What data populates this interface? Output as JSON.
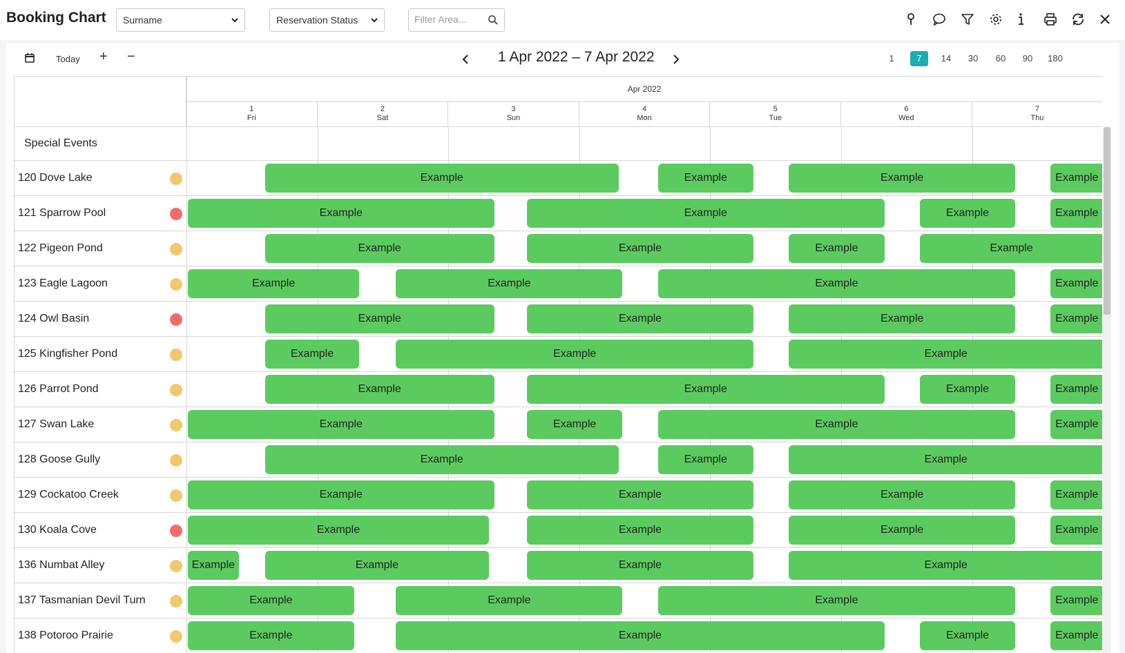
{
  "app": {
    "title": "Booking Chart",
    "sort_select": "Surname",
    "status_select": "Reservation Status",
    "search_placeholder": "Filter Area..."
  },
  "toolbar": {
    "today_label": "Today",
    "plus_label": "+",
    "minus_label": "−",
    "range_label": "1 Apr 2022 – 7 Apr 2022",
    "zoom_options": [
      "1",
      "7",
      "14",
      "30",
      "60",
      "90",
      "180"
    ],
    "zoom_active": "7"
  },
  "grid": {
    "month_label": "Apr 2022",
    "days": [
      {
        "num": "1",
        "dow": "Fri"
      },
      {
        "num": "2",
        "dow": "Sat"
      },
      {
        "num": "3",
        "dow": "Sun"
      },
      {
        "num": "4",
        "dow": "Mon"
      },
      {
        "num": "5",
        "dow": "Tue"
      },
      {
        "num": "6",
        "dow": "Wed"
      },
      {
        "num": "7",
        "dow": "Thu"
      }
    ],
    "special_events_label": "Special Events",
    "booking_label": "Example",
    "rows": [
      {
        "name": "120 Dove Lake",
        "status": "yellow",
        "bookings": [
          [
            0.6,
            3.3
          ],
          [
            3.6,
            4.33
          ],
          [
            4.6,
            6.33
          ],
          [
            6.6,
            7.0
          ]
        ]
      },
      {
        "name": "121 Sparrow Pool",
        "status": "red",
        "bookings": [
          [
            0.0,
            2.35
          ],
          [
            2.6,
            5.33
          ],
          [
            5.6,
            6.33
          ],
          [
            6.6,
            7.0
          ]
        ]
      },
      {
        "name": "122 Pigeon Pond",
        "status": "yellow",
        "bookings": [
          [
            0.6,
            2.35
          ],
          [
            2.6,
            4.33
          ],
          [
            4.6,
            5.33
          ],
          [
            5.6,
            7.0
          ]
        ]
      },
      {
        "name": "123 Eagle Lagoon",
        "status": "yellow",
        "bookings": [
          [
            0.0,
            1.32
          ],
          [
            1.6,
            3.33
          ],
          [
            3.6,
            6.33
          ],
          [
            6.6,
            7.0
          ]
        ]
      },
      {
        "name": "124 Owl Basin",
        "status": "red",
        "bookings": [
          [
            0.6,
            2.35
          ],
          [
            2.6,
            4.33
          ],
          [
            4.6,
            6.33
          ],
          [
            6.6,
            7.0
          ]
        ]
      },
      {
        "name": "125 Kingfisher Pond",
        "status": "yellow",
        "bookings": [
          [
            0.6,
            1.32
          ],
          [
            1.6,
            4.33
          ],
          [
            4.6,
            7.0
          ]
        ]
      },
      {
        "name": "126 Parrot Pond",
        "status": "yellow",
        "bookings": [
          [
            0.6,
            2.35
          ],
          [
            2.6,
            5.33
          ],
          [
            5.6,
            6.33
          ],
          [
            6.6,
            7.0
          ]
        ]
      },
      {
        "name": "127 Swan Lake",
        "status": "yellow",
        "bookings": [
          [
            0.0,
            2.35
          ],
          [
            2.6,
            3.33
          ],
          [
            3.6,
            6.33
          ],
          [
            6.6,
            7.0
          ]
        ]
      },
      {
        "name": "128 Goose Gully",
        "status": "yellow",
        "bookings": [
          [
            0.6,
            3.3
          ],
          [
            3.6,
            4.33
          ],
          [
            4.6,
            7.0
          ]
        ]
      },
      {
        "name": "129 Cockatoo Creek",
        "status": "yellow",
        "bookings": [
          [
            0.0,
            2.35
          ],
          [
            2.6,
            4.33
          ],
          [
            4.6,
            6.33
          ],
          [
            6.6,
            7.0
          ]
        ]
      },
      {
        "name": "130 Koala Cove",
        "status": "red",
        "bookings": [
          [
            0.0,
            2.31
          ],
          [
            2.6,
            4.33
          ],
          [
            4.6,
            6.33
          ],
          [
            6.6,
            7.0
          ]
        ]
      },
      {
        "name": "136 Numbat Alley",
        "status": "yellow",
        "bookings": [
          [
            0.0,
            0.4
          ],
          [
            0.6,
            2.31
          ],
          [
            2.6,
            4.33
          ],
          [
            4.6,
            7.0
          ]
        ]
      },
      {
        "name": "137 Tasmanian Devil Turn",
        "status": "yellow",
        "bookings": [
          [
            0.0,
            1.28
          ],
          [
            1.6,
            3.33
          ],
          [
            3.6,
            6.33
          ],
          [
            6.6,
            7.0
          ]
        ]
      },
      {
        "name": "138 Potoroo Prairie",
        "status": "yellow",
        "bookings": [
          [
            0.0,
            1.28
          ],
          [
            1.6,
            5.33
          ],
          [
            5.6,
            6.33
          ],
          [
            6.6,
            7.0
          ]
        ]
      }
    ]
  },
  "colors": {
    "booking": "#5ccb5f",
    "status_yellow": "#f2c76e",
    "status_red": "#f26b6b",
    "accent": "#1aaeb0"
  }
}
